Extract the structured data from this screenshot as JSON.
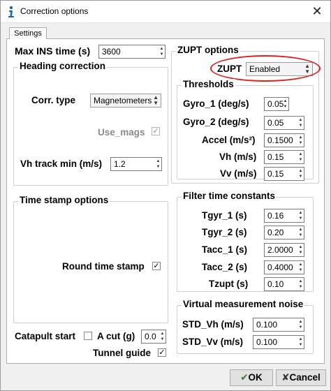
{
  "window": {
    "title": "Correction options",
    "close_glyph": "✕"
  },
  "tabs": [
    {
      "label": "Settings"
    }
  ],
  "left": {
    "max_ins_time": {
      "label": "Max INS time (s)",
      "value": "3600"
    },
    "heading_correction": {
      "title": "Heading correction",
      "corr_type": {
        "label": "Corr. type",
        "selected": "Magnetometers"
      },
      "use_mags": {
        "label": "Use_mags",
        "checked": true
      },
      "vh_track_min": {
        "label": "Vh track min (m/s)",
        "value": "1.2"
      }
    },
    "time_stamp": {
      "title": "Time stamp options",
      "round_time_stamp": {
        "label": "Round time stamp",
        "checked": true
      }
    },
    "catapult_start": {
      "label": "Catapult start",
      "checked": false
    },
    "a_cut": {
      "label": "A cut (g)",
      "value": "0.0"
    },
    "tunnel_guide": {
      "label": "Tunnel guide",
      "checked": true
    }
  },
  "right": {
    "zupt_options": {
      "title": "ZUPT options",
      "zupt": {
        "label": "ZUPT",
        "selected": "Enabled"
      },
      "thresholds": {
        "title": "Thresholds",
        "rows": [
          {
            "label": "Gyro_1 (deg/s)",
            "value": "0.05"
          },
          {
            "label": "Gyro_2 (deg/s)",
            "value": "0.05"
          },
          {
            "label": "Accel (m/s²)",
            "value": "0.1500"
          },
          {
            "label": "Vh (m/s)",
            "value": "0.15"
          },
          {
            "label": "Vv (m/s)",
            "value": "0.15"
          }
        ]
      }
    },
    "filter_time_constants": {
      "title": "Filter time constants",
      "rows": [
        {
          "label": "Tgyr_1 (s)",
          "value": "0.16"
        },
        {
          "label": "Tgyr_2 (s)",
          "value": "0.20"
        },
        {
          "label": "Tacc_1 (s)",
          "value": "2.0000"
        },
        {
          "label": "Tacc_2 (s)",
          "value": "0.4000"
        },
        {
          "label": "Tzupt (s)",
          "value": "0.10"
        }
      ]
    },
    "virtual_noise": {
      "title": "Virtual measurement noise",
      "rows": [
        {
          "label": "STD_Vh (m/s)",
          "value": "0.100"
        },
        {
          "label": "STD_Vv (m/s)",
          "value": "0.100"
        }
      ]
    }
  },
  "buttons": {
    "ok": {
      "label": "OK",
      "icon": "check-icon"
    },
    "cancel": {
      "label": "Cancel",
      "icon": "cross-icon"
    }
  },
  "annotation": {
    "color": "#e0201e"
  }
}
